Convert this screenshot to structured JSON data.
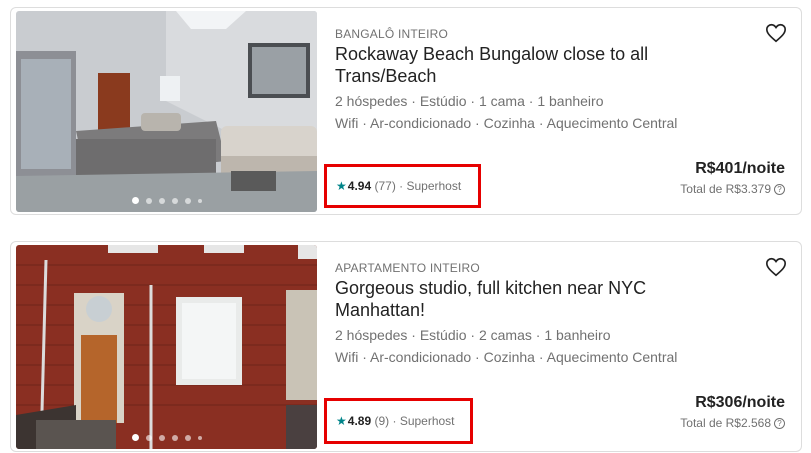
{
  "listings": [
    {
      "type": "BANGALÔ INTEIRO",
      "title": "Rockaway Beach Bungalow close to all Trans/Beach",
      "details": "2 hóspedes · Estúdio · 1 cama · 1 banheiro",
      "amenities": "Wifi · Ar-condicionado · Cozinha · Aquecimento Central",
      "rating": "4.94",
      "reviews": "(77)",
      "badge": "· Superhost",
      "price": "R$401/noite",
      "total": "Total de R$3.379",
      "photo_icon": "bedroom-photo",
      "heart_icon": "heart-icon"
    },
    {
      "type": "APARTAMENTO INTEIRO",
      "title": "Gorgeous studio, full kitchen near NYC Manhattan!",
      "details": "2 hóspedes · Estúdio · 2 camas · 1 banheiro",
      "amenities": "Wifi · Ar-condicionado · Cozinha · Aquecimento Central",
      "rating": "4.89",
      "reviews": "(9)",
      "badge": "· Superhost",
      "price": "R$306/noite",
      "total": "Total de R$2.568",
      "photo_icon": "brick-building-photo",
      "heart_icon": "heart-icon"
    }
  ],
  "colors": {
    "star": "#008489",
    "highlight_border": "#e60000",
    "muted_text": "#717171"
  },
  "icons": {
    "star": "★",
    "help": "?"
  }
}
